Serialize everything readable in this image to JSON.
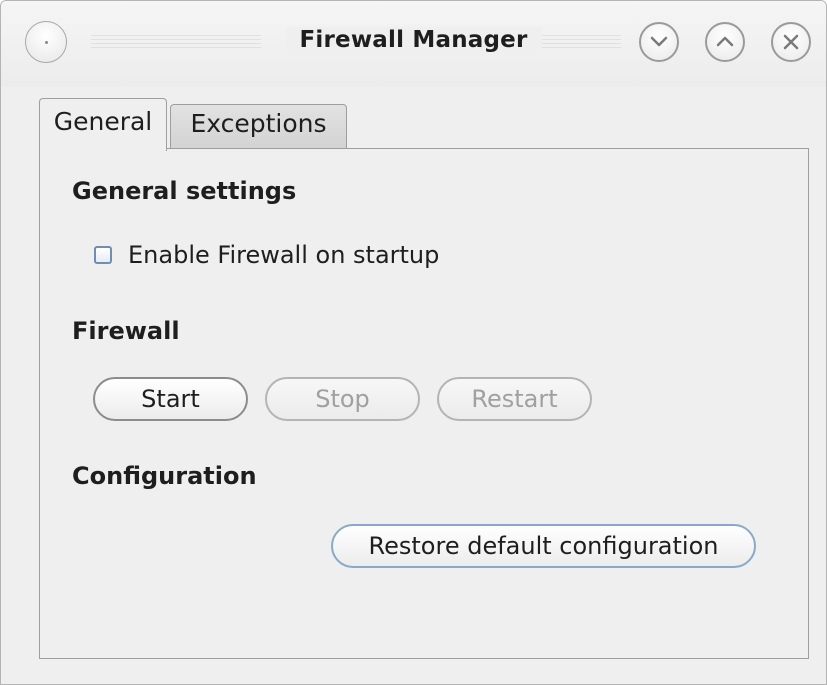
{
  "window": {
    "title": "Firewall Manager"
  },
  "tabs": [
    {
      "label": "General",
      "active": true
    },
    {
      "label": "Exceptions",
      "active": false
    }
  ],
  "general": {
    "settings_heading": "General settings",
    "enable_on_startup": {
      "label": "Enable Firewall on startup",
      "checked": false
    },
    "firewall_heading": "Firewall",
    "buttons": {
      "start": {
        "label": "Start",
        "enabled": true
      },
      "stop": {
        "label": "Stop",
        "enabled": false
      },
      "restart": {
        "label": "Restart",
        "enabled": false
      }
    },
    "configuration_heading": "Configuration",
    "restore_button": "Restore default configuration"
  },
  "icons": {
    "window_menu": "circle-dot-icon",
    "minimize": "chevron-down-icon",
    "maximize": "chevron-up-icon",
    "close": "close-icon"
  },
  "colors": {
    "window_bg": "#efefef",
    "border": "#9e9e9e",
    "focus_accent": "#88a9c9",
    "disabled_text": "#a0a0a0"
  }
}
